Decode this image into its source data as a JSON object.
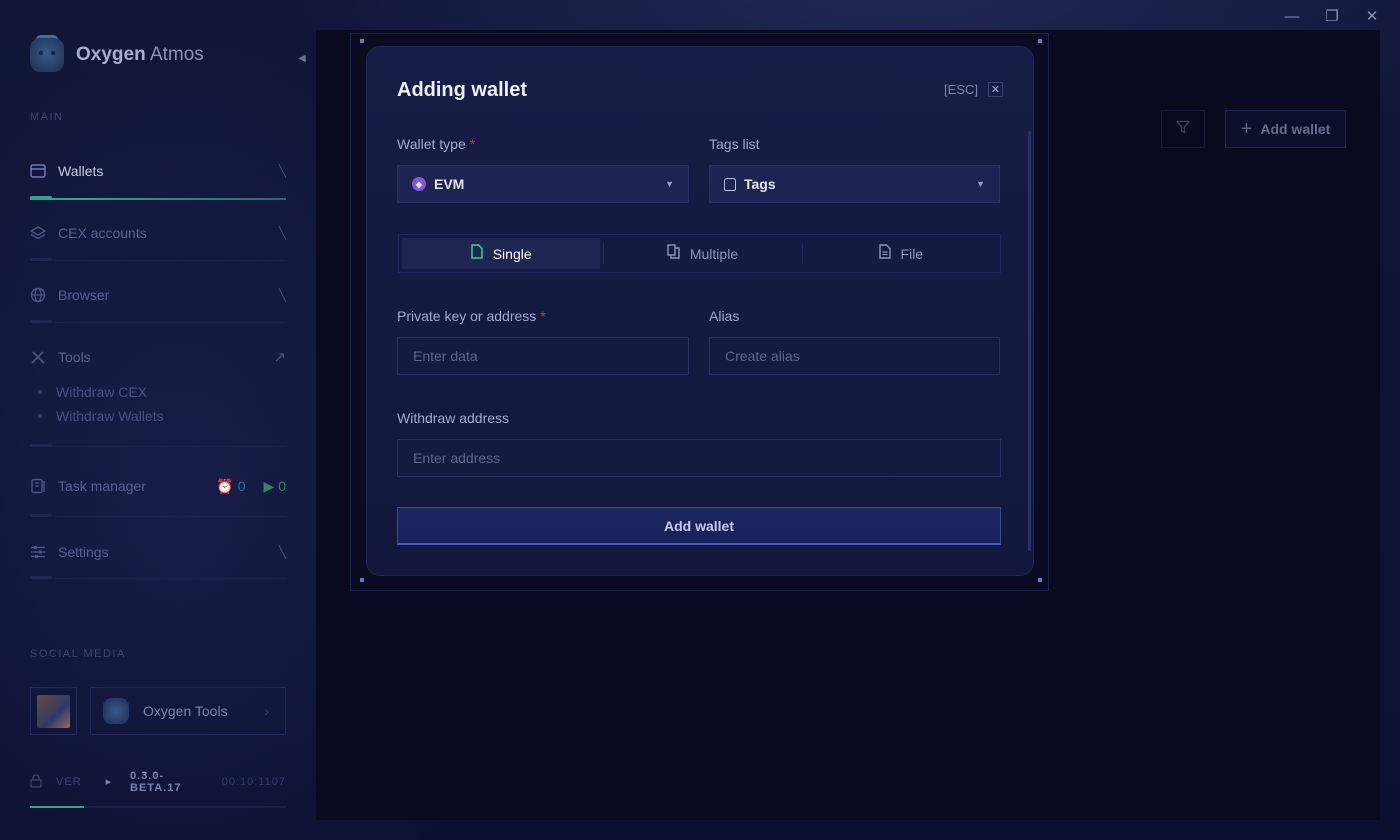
{
  "app": {
    "brand_bold": "Oxygen",
    "brand_light": "Atmos",
    "window_controls": [
      "minimize",
      "restore",
      "close"
    ]
  },
  "sidebar": {
    "main_label": "MAIN",
    "items": [
      {
        "label": "Wallets",
        "icon": "wallet-icon",
        "active": true
      },
      {
        "label": "CEX accounts",
        "icon": "layers-icon",
        "active": false
      },
      {
        "label": "Browser",
        "icon": "globe-icon",
        "active": false
      },
      {
        "label": "Tools",
        "icon": "tools-icon",
        "active": false
      }
    ],
    "tools_sub": [
      "Withdraw CEX",
      "Withdraw Wallets"
    ],
    "task_manager": {
      "label": "Task manager",
      "scheduled": "0",
      "running": "0"
    },
    "settings_label": "Settings",
    "social_label": "SOCIAL MEDIA",
    "social_card": "Oxygen Tools",
    "version_label": "VER",
    "version_line1": "0.3.0-",
    "version_line2": "BETA.17",
    "time": "00:10:1107"
  },
  "main": {
    "add_wallet_label": "Add wallet"
  },
  "modal": {
    "title": "Adding wallet",
    "esc_label": "[ESC]",
    "wallet_type_label": "Wallet type",
    "wallet_type_value": "EVM",
    "tags_label": "Tags list",
    "tags_value": "Tags",
    "modes": [
      {
        "label": "Single",
        "active": true
      },
      {
        "label": "Multiple",
        "active": false
      },
      {
        "label": "File",
        "active": false
      }
    ],
    "private_key_label": "Private key or address",
    "private_key_placeholder": "Enter data",
    "alias_label": "Alias",
    "alias_placeholder": "Create alias",
    "withdraw_label": "Withdraw address",
    "withdraw_placeholder": "Enter address",
    "submit_label": "Add wallet",
    "required_mark": "*"
  },
  "colors": {
    "accent_green": "#2ea58f",
    "accent_blue": "#4460c8",
    "required_red": "#d2374e",
    "evm_purple": "#7b5cd6"
  }
}
